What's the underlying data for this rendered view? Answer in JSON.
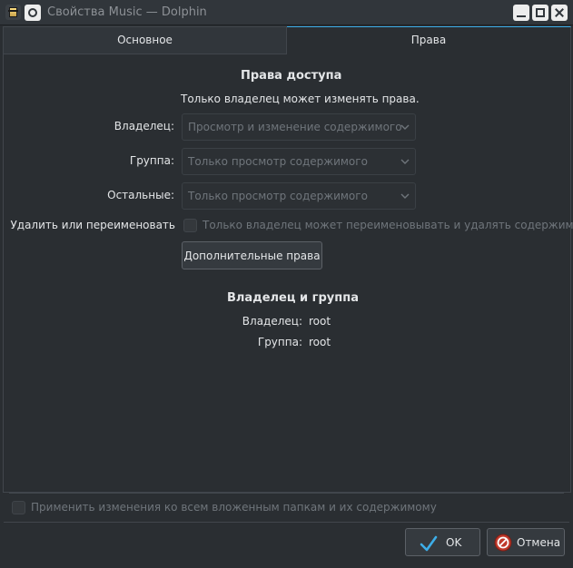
{
  "window": {
    "title": "Свойства Music — Dolphin",
    "icons": [
      "folder-icon",
      "pin-icon",
      "minimize-icon",
      "maximize-icon",
      "close-icon"
    ]
  },
  "tabs": [
    {
      "label": "Основное",
      "active": false
    },
    {
      "label": "Права",
      "active": true
    }
  ],
  "permissions": {
    "heading": "Права доступа",
    "note": "Только владелец может изменять права.",
    "owner_label": "Владелец:",
    "owner_value": "Просмотр и изменение содержимого",
    "group_label": "Группа:",
    "group_value": "Только просмотр содержимого",
    "others_label": "Остальные:",
    "others_value": "Только просмотр содержимого",
    "delete_label": "Удалить или переименовать",
    "delete_checkbox_label": "Только владелец может переименовывать и удалять содержимое",
    "delete_checked": false,
    "advanced_button": "Дополнительные права"
  },
  "ownership": {
    "heading": "Владелец и группа",
    "owner_label": "Владелец:",
    "owner_value": "root",
    "group_label": "Группа:",
    "group_value": "root"
  },
  "footer": {
    "apply_recursive_label": "Применить изменения ко всем вложенным папкам и их содержимому",
    "apply_recursive_checked": false,
    "ok_label": "OK",
    "cancel_label": "Отмена"
  },
  "colors": {
    "background": "#2a2e32",
    "accent": "#3daee9",
    "text": "#e4e6e8",
    "disabled_text": "#6f757b"
  }
}
